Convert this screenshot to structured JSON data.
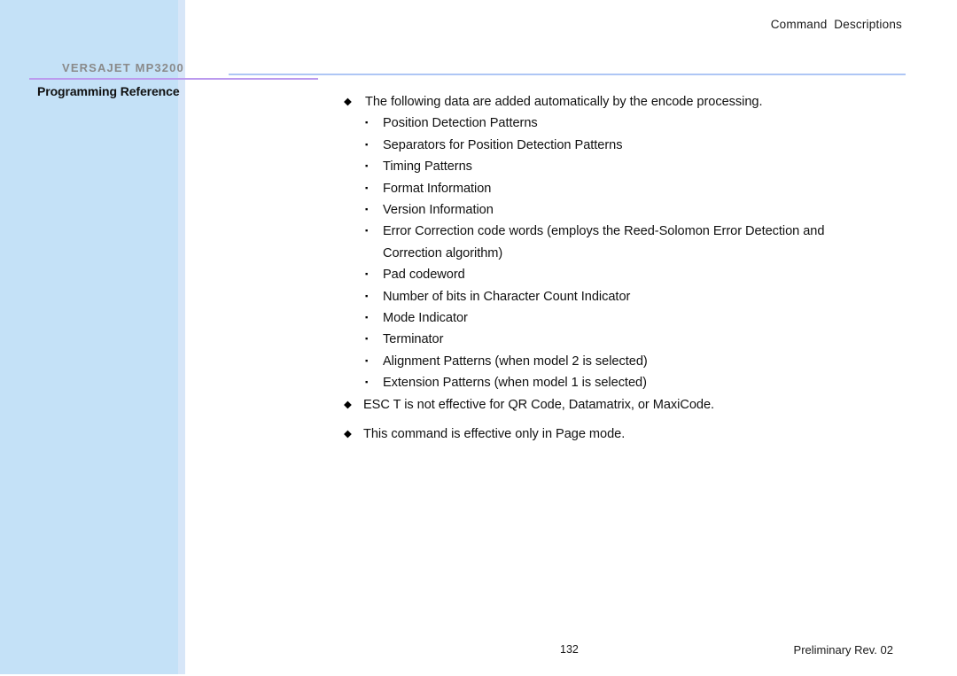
{
  "header": {
    "running_head": "Command  Descriptions"
  },
  "sidebar": {
    "product_name": "VERSAJET MP3200",
    "document_subtitle": "Programming Reference",
    "band_color": "#c4e1f7",
    "rule_purple_color": "#bb9aee",
    "rule_blue_color": "#aec6f5"
  },
  "content": {
    "intro": {
      "marker": "◆",
      "text": "The following data are added automatically by the encode processing."
    },
    "sub_marker": "▪",
    "sub_items": [
      {
        "text": "Position Detection Patterns"
      },
      {
        "text": "Separators for Position Detection Patterns"
      },
      {
        "text": "Timing Patterns"
      },
      {
        "text": "Format Information"
      },
      {
        "text": "Version Information"
      },
      {
        "text": "Error Correction code words (employs the Reed-Solomon Error Detection and",
        "continuation": "Correction algorithm)"
      },
      {
        "text": "Pad codeword"
      },
      {
        "text": "Number of bits in Character Count Indicator"
      },
      {
        "text": "Mode Indicator"
      },
      {
        "text": "Terminator"
      },
      {
        "text": "Alignment Patterns (when model 2 is selected)"
      },
      {
        "text": "Extension Patterns (when model 1 is selected)"
      }
    ],
    "notes": [
      {
        "marker": "◆",
        "text": "ESC T is not effective for QR Code, Datamatrix, or MaxiCode."
      },
      {
        "marker": "◆",
        "text": "This command is effective only in Page mode."
      }
    ]
  },
  "footer": {
    "page_number": "132",
    "revision": "Preliminary Rev. 02"
  }
}
